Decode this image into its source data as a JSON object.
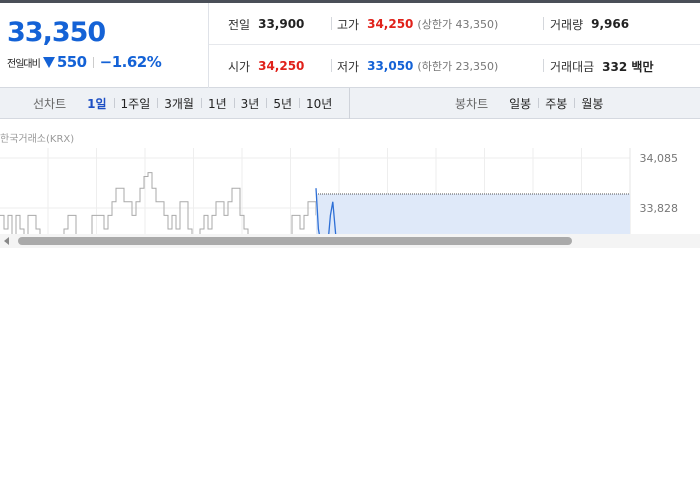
{
  "summary": {
    "current_price": "33,350",
    "change_label": "전일대비",
    "change_icon": "down-triangle-icon",
    "change_amount": "550",
    "change_percent": "−1.62%"
  },
  "stats": {
    "prev_close": {
      "label": "전일",
      "value": "33,900"
    },
    "high": {
      "label": "고가",
      "value": "34,250",
      "sub": "(상한가 43,350)"
    },
    "volume": {
      "label": "거래량",
      "value": "9,966"
    },
    "open": {
      "label": "시가",
      "value": "34,250"
    },
    "low": {
      "label": "저가",
      "value": "33,050",
      "sub": "(하한가 23,350)"
    },
    "trade_value": {
      "label": "거래대금",
      "value": "332 백만"
    }
  },
  "toolbar": {
    "line_chart_title": "선차트",
    "line_ranges": [
      "1일",
      "1주일",
      "3개월",
      "1년",
      "3년",
      "5년",
      "10년"
    ],
    "active_range": "1일",
    "candle_chart_title": "봉차트",
    "candle_ranges": [
      "일봉",
      "주봉",
      "월봉"
    ]
  },
  "chart_data": {
    "type": "line",
    "source_label": "한국거래소(KRX)",
    "y_ticks": [
      "34,085",
      "33,828"
    ],
    "y_tick_values": [
      34085,
      33828
    ],
    "prev_close_reference": 33900,
    "series": [
      {
        "color": "#aaaaaa",
        "values": [
          33790,
          33720,
          33790,
          33650,
          33790,
          33720,
          33650,
          33790,
          33790,
          33720,
          33650,
          33650,
          33650,
          33650,
          33650,
          33650,
          33720,
          33790,
          33790,
          33650,
          33650,
          33650,
          33650,
          33790,
          33790,
          33790,
          33720,
          33790,
          33860,
          33930,
          33930,
          33860,
          33860,
          33790,
          33860,
          33930,
          33990,
          34010,
          33930,
          33860,
          33860,
          33790,
          33720,
          33790,
          33720,
          33860,
          33860,
          33720,
          33650,
          33650,
          33720,
          33790,
          33720,
          33790,
          33860,
          33860,
          33790,
          33860,
          33930,
          33930,
          33790,
          33720,
          33650,
          33650,
          33650,
          33650,
          33650,
          33650,
          33650,
          33650,
          33650,
          33650,
          33650,
          33790,
          33790,
          33720,
          33790,
          33860,
          33860,
          33790
        ]
      },
      {
        "color": "#2d6fd6",
        "values": [
          33930,
          33720,
          33650,
          33580,
          33580,
          33650,
          33790,
          33860,
          33720,
          33580
        ]
      }
    ],
    "line_color": "#2d6fd6",
    "fill_color": "#dfe9f9",
    "grid_color": "#eeeeee"
  },
  "colors": {
    "price_down": "#1462d6",
    "price_up": "#e0211a",
    "active_tab": "#1d4fc4"
  }
}
